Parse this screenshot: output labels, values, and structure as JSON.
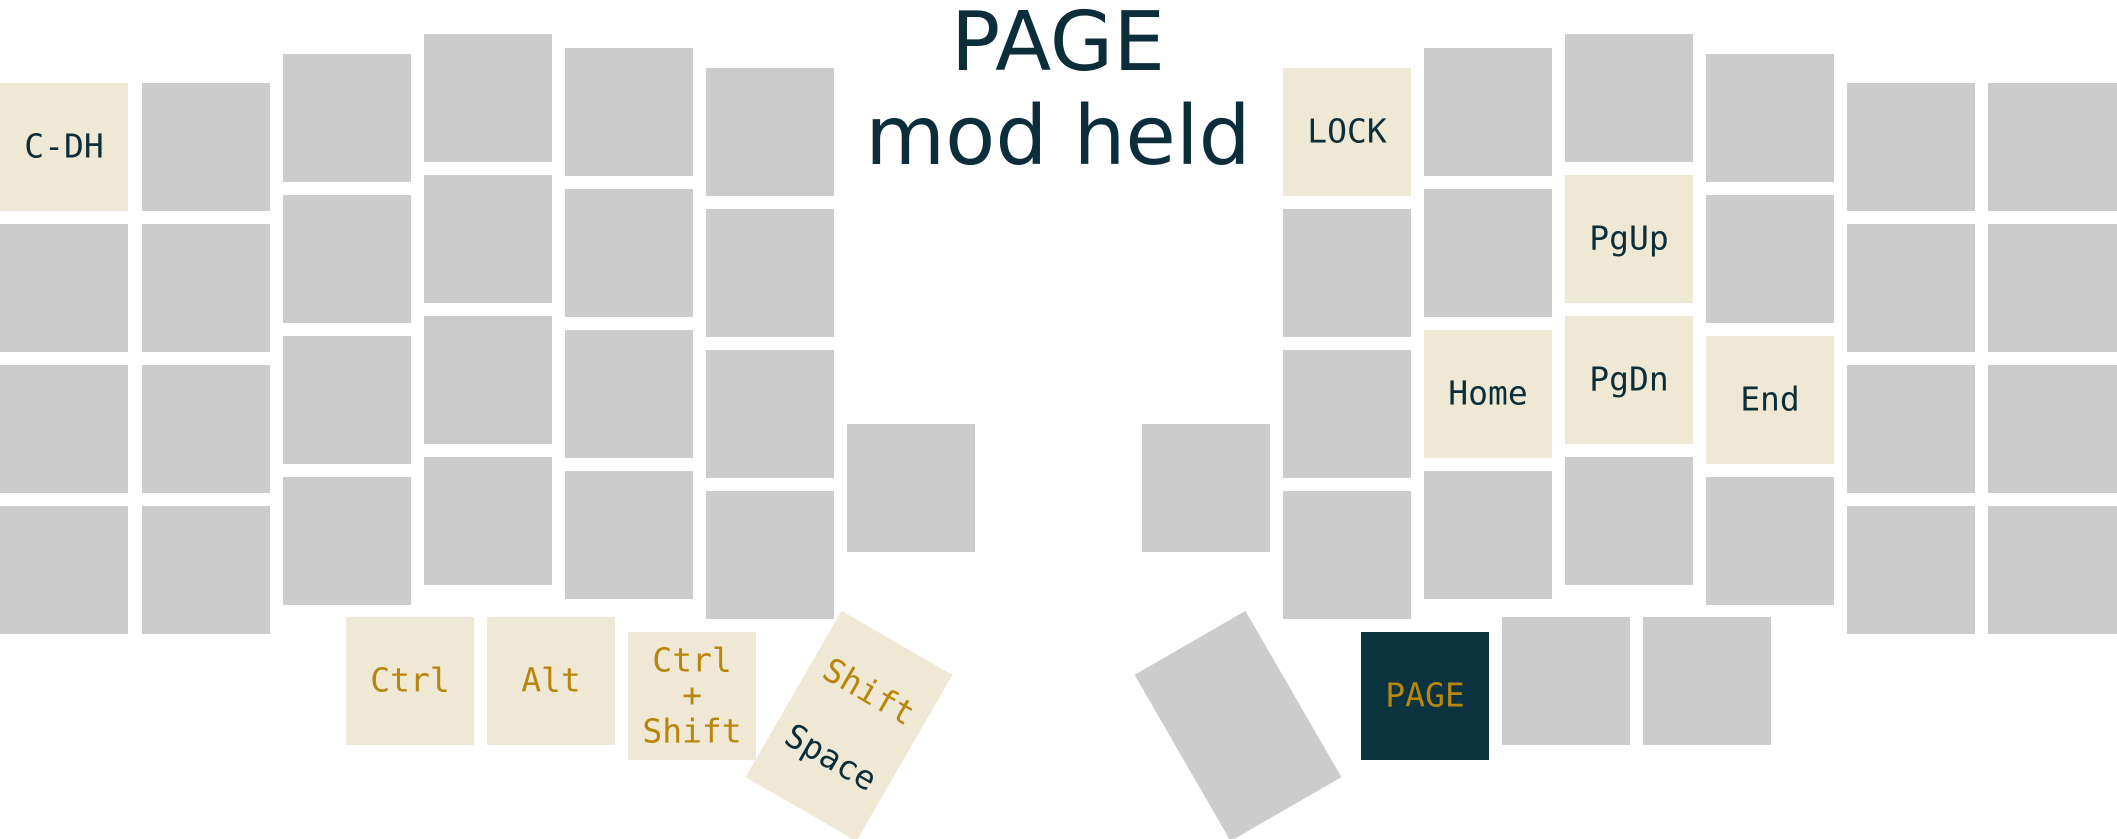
{
  "title": {
    "line1": "PAGE",
    "line2": "mod held"
  },
  "colors": {
    "key_blank": "#cccccc",
    "key_highlight": "#efe8d5",
    "key_active": "#0b3340",
    "text_dark": "#0b2e3a",
    "text_mod": "#b8860b"
  },
  "keys": {
    "c_dh": "C-DH",
    "lock": "LOCK",
    "pgup": "PgUp",
    "home": "Home",
    "pgdn": "PgDn",
    "end": "End",
    "ctrl": "Ctrl",
    "alt": "Alt",
    "ctrl_shift": {
      "line1": "Ctrl",
      "line2": "+",
      "line3": "Shift"
    },
    "shift": "Shift",
    "space": "Space",
    "page": "PAGE"
  }
}
